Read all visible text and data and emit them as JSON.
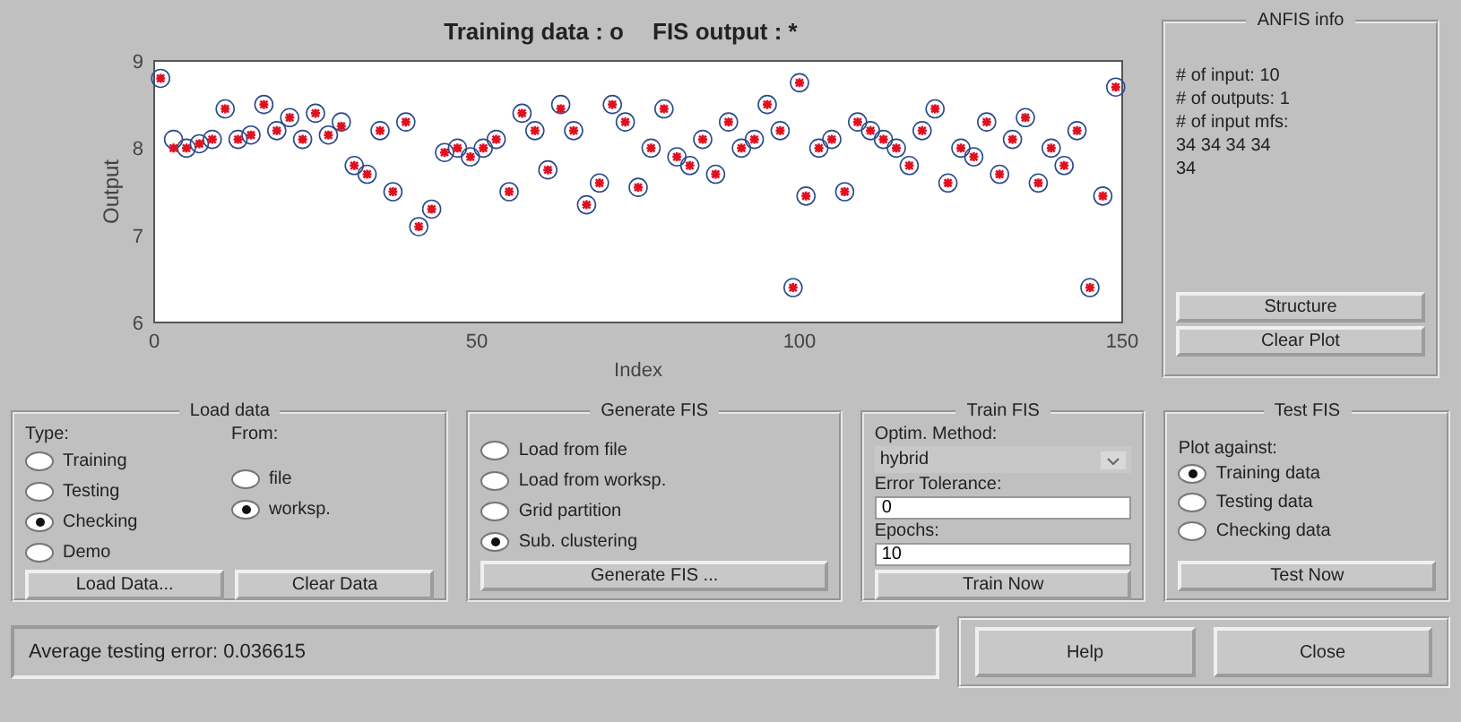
{
  "plot": {
    "chart_data": {
      "type": "scatter",
      "xlabel": "Index",
      "ylabel": "Output",
      "xlim": [
        0,
        150
      ],
      "ylim": [
        6,
        9
      ],
      "xticks": [
        0,
        50,
        100,
        150
      ],
      "yticks": [
        6,
        7,
        8,
        9
      ],
      "x": [
        1,
        3,
        5,
        7,
        9,
        11,
        13,
        15,
        17,
        19,
        21,
        23,
        25,
        27,
        29,
        31,
        33,
        35,
        37,
        39,
        41,
        43,
        45,
        47,
        49,
        51,
        53,
        55,
        57,
        59,
        61,
        63,
        65,
        67,
        69,
        71,
        73,
        75,
        77,
        79,
        81,
        83,
        85,
        87,
        89,
        91,
        93,
        95,
        97,
        99,
        100,
        101,
        103,
        105,
        107,
        109,
        111,
        113,
        115,
        117,
        119,
        121,
        123,
        125,
        127,
        129,
        131,
        133,
        135,
        137,
        139,
        141,
        143,
        145,
        147,
        149
      ],
      "series": [
        {
          "name": "Training data : o",
          "color": "#2a4a8a",
          "values": [
            8.8,
            8.1,
            8.0,
            8.05,
            8.1,
            8.45,
            8.1,
            8.15,
            8.5,
            8.2,
            8.35,
            8.1,
            8.4,
            8.15,
            8.3,
            7.8,
            7.7,
            8.2,
            7.5,
            8.3,
            7.1,
            7.3,
            7.95,
            8.0,
            7.9,
            8.0,
            8.1,
            7.5,
            8.4,
            8.2,
            7.75,
            8.5,
            8.2,
            7.35,
            7.6,
            8.5,
            8.3,
            7.55,
            8.0,
            8.45,
            7.9,
            7.8,
            8.1,
            7.7,
            8.3,
            8.0,
            8.1,
            8.5,
            8.2,
            6.4,
            8.75,
            7.45,
            8.0,
            8.1,
            7.5,
            8.3,
            8.2,
            8.1,
            8.0,
            7.8,
            8.2,
            8.45,
            7.6,
            8.0,
            7.9,
            8.3,
            7.7,
            8.1,
            8.35,
            7.6,
            8.0,
            7.8,
            8.2,
            6.4,
            7.45,
            8.7
          ]
        },
        {
          "name": "FIS output : *",
          "color": "#e01020",
          "values": [
            8.8,
            8.0,
            8.0,
            8.05,
            8.1,
            8.45,
            8.1,
            8.15,
            8.5,
            8.2,
            8.35,
            8.1,
            8.4,
            8.15,
            8.25,
            7.8,
            7.7,
            8.2,
            7.5,
            8.3,
            7.1,
            7.3,
            7.95,
            8.0,
            7.9,
            8.0,
            8.1,
            7.5,
            8.4,
            8.2,
            7.75,
            8.45,
            8.2,
            7.35,
            7.6,
            8.5,
            8.3,
            7.55,
            8.0,
            8.45,
            7.9,
            7.8,
            8.1,
            7.7,
            8.3,
            8.0,
            8.1,
            8.5,
            8.2,
            6.4,
            8.75,
            7.45,
            8.0,
            8.1,
            7.5,
            8.3,
            8.2,
            8.1,
            8.0,
            7.8,
            8.2,
            8.45,
            7.6,
            8.0,
            7.9,
            8.3,
            7.7,
            8.1,
            8.35,
            7.6,
            8.0,
            7.8,
            8.2,
            6.4,
            7.45,
            8.7
          ]
        }
      ]
    }
  },
  "anfis_info": {
    "title": "ANFIS info",
    "lines": [
      "# of input: 10",
      "# of outputs: 1",
      "# of input mfs:",
      "34  34  34  34",
      "34"
    ],
    "buttons": [
      "Structure",
      "Clear Plot"
    ]
  },
  "load_data": {
    "title": "Load data",
    "type_label": "Type:",
    "from_label": "From:",
    "types": [
      {
        "label": "Training",
        "selected": false
      },
      {
        "label": "Testing",
        "selected": false
      },
      {
        "label": "Checking",
        "selected": true
      },
      {
        "label": "Demo",
        "selected": false
      }
    ],
    "sources": [
      {
        "label": "file",
        "selected": false
      },
      {
        "label": "worksp.",
        "selected": true
      }
    ],
    "buttons": [
      "Load Data...",
      "Clear Data"
    ]
  },
  "generate_fis": {
    "title": "Generate FIS",
    "options": [
      {
        "label": "Load from file",
        "selected": false
      },
      {
        "label": "Load from worksp.",
        "selected": false
      },
      {
        "label": "Grid partition",
        "selected": false
      },
      {
        "label": "Sub. clustering",
        "selected": true
      }
    ],
    "button": "Generate FIS ..."
  },
  "train_fis": {
    "title": "Train FIS",
    "method_label": "Optim. Method:",
    "method": "hybrid",
    "tolerance_label": "Error Tolerance:",
    "tolerance": "0",
    "epochs_label": "Epochs:",
    "epochs": "10",
    "button": "Train Now"
  },
  "test_fis": {
    "title": "Test FIS",
    "plot_label": "Plot against:",
    "options": [
      {
        "label": "Training data",
        "selected": true
      },
      {
        "label": "Testing data",
        "selected": false
      },
      {
        "label": "Checking data",
        "selected": false
      }
    ],
    "button": "Test Now"
  },
  "status": "Average testing error: 0.036615",
  "buttons": [
    "Help",
    "Close"
  ]
}
